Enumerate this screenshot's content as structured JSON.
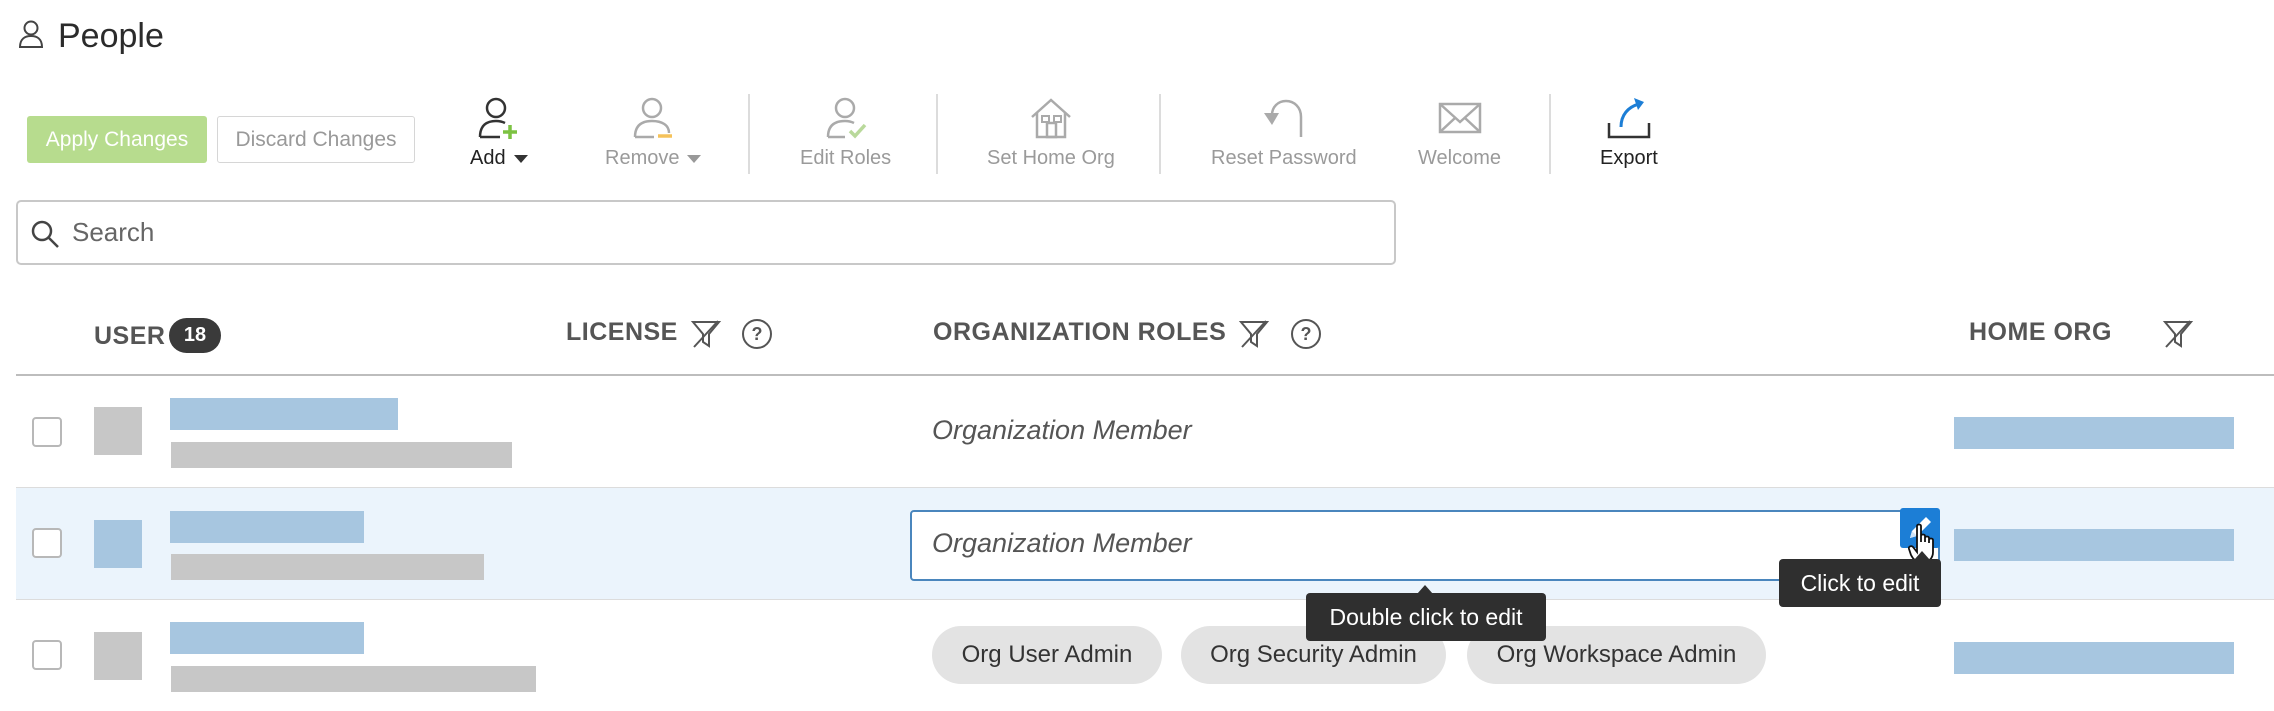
{
  "page": {
    "title": "People",
    "title_icon": "person-outline-icon"
  },
  "toolbar": {
    "apply_label": "Apply Changes",
    "discard_label": "Discard Changes",
    "add_label": "Add",
    "remove_label": "Remove",
    "edit_roles_label": "Edit Roles",
    "set_home_org_label": "Set Home Org",
    "reset_password_label": "Reset Password",
    "welcome_label": "Welcome",
    "export_label": "Export"
  },
  "search": {
    "placeholder": "Search",
    "value": ""
  },
  "table": {
    "headers": {
      "user": "USER",
      "user_count": "18",
      "license": "LICENSE",
      "org_roles": "ORGANIZATION ROLES",
      "home_org": "HOME ORG"
    },
    "rows": [
      {
        "role_text": "Organization Member",
        "selected": false
      },
      {
        "role_text": "Organization Member",
        "selected": false,
        "editing": true
      },
      {
        "chips": [
          "Org User Admin",
          "Org Security Admin",
          "Org Workspace Admin"
        ],
        "selected": false
      }
    ]
  },
  "tooltips": {
    "double_click": "Double click to edit",
    "click": "Click to edit"
  },
  "colors": {
    "apply_bg": "#b7dc8e",
    "placeholder_blue": "#a7c6e0",
    "placeholder_gray": "#c7c7c7",
    "highlight_row": "#ebf4fc",
    "accent": "#1c7ed6",
    "add_icon_plus": "#7cc242"
  }
}
